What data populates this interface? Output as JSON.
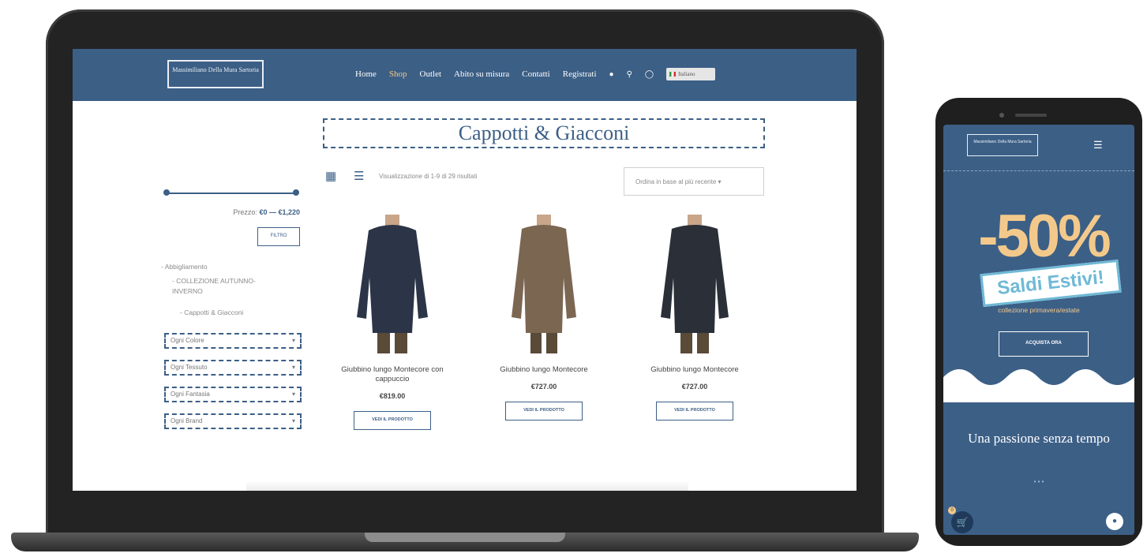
{
  "header": {
    "logo_text": "Massimiliano Della Mura Sartoria",
    "nav": [
      {
        "label": "Home"
      },
      {
        "label": "Shop",
        "active": true
      },
      {
        "label": "Outlet"
      },
      {
        "label": "Abito su misura"
      },
      {
        "label": "Contatti"
      },
      {
        "label": "Registrati"
      }
    ],
    "icons": [
      "user-icon",
      "search-icon",
      "instagram-icon"
    ],
    "language": "Italiano"
  },
  "main": {
    "title": "Cappotti & Giacconi",
    "result_count": "Visualizzazione di 1-9 di 29 risultati",
    "sort": "Ordina in base al più recente"
  },
  "sidebar": {
    "price_prefix": "Prezzo:",
    "price_range": "€0 — €1,220",
    "filter_label": "FILTRO",
    "categories": [
      "Abbigliamento",
      "COLLEZIONE AUTUNNO-INVERNO",
      "Cappotti & Giacconi"
    ],
    "dropdowns": [
      "Ogni Colore",
      "Ogni Tessuto",
      "Ogni Fantasia",
      "Ogni Brand"
    ]
  },
  "products": [
    {
      "name": "Giubbino lungo Montecore con cappuccio",
      "price": "€819.00",
      "button": "VEDI IL PRODOTTO"
    },
    {
      "name": "Giubbino lungo Montecore",
      "price": "€727.00",
      "button": "VEDI IL PRODOTTO"
    },
    {
      "name": "Giubbino lungo Montecore",
      "price": "€727.00",
      "button": "VEDI IL PRODOTTO"
    }
  ],
  "phone": {
    "logo_text": "Massimiliano Della Mura Sartoria",
    "sale_text": "-50%",
    "banner_text": "Saldi Estivi!",
    "sub_text": "collezione primavera/estate",
    "cta": "ACQUISTA ORA",
    "heading": "Una passione senza tempo",
    "cart_count": "0"
  },
  "colors": {
    "brand": "#3c5f86",
    "accent": "#f3c98b",
    "banner": "#6fb9d6"
  }
}
